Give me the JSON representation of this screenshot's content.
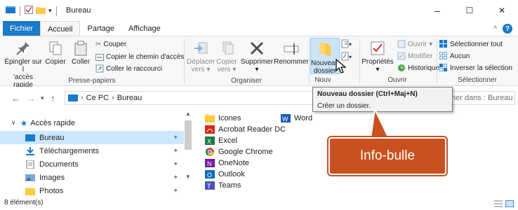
{
  "window": {
    "title": "Bureau",
    "controls": {
      "minimize": "–",
      "maximize": "☐",
      "close": "✕"
    }
  },
  "menu_tabs": [
    {
      "label": "Fichier"
    },
    {
      "label": "Accueil"
    },
    {
      "label": "Partage"
    },
    {
      "label": "Affichage"
    }
  ],
  "ribbon": {
    "groups": {
      "presse_papiers": "Presse-papiers",
      "organiser": "Organiser",
      "nouveau": "Nouv",
      "ouvrir": "Ouvrir",
      "selectionner": "Sélectionner"
    },
    "buttons": {
      "epingler": [
        "Épingler sur l",
        "'accès rapide"
      ],
      "copier": "Copier",
      "coller": "Coller",
      "couper": "Couper",
      "copier_chemin": "Copier le chemin d'accès",
      "coller_raccourci": "Coller le raccourci",
      "deplacer": [
        "Déplacer",
        "vers"
      ],
      "copier_vers": [
        "Copier",
        "vers"
      ],
      "supprimer": "Supprimer",
      "renommer": "Renommer",
      "nouveau_dossier": [
        "Nouveau",
        "dossier"
      ],
      "proprietes": "Propriétés",
      "ouvrir": "Ouvrir",
      "modifier": "Modifier",
      "historique": "Historique",
      "selectionner_tout": "Sélectionner tout",
      "aucun": "Aucun",
      "inverser": "Inverser la sélection"
    }
  },
  "address": {
    "path_root": "Ce PC",
    "path_current": "Bureau",
    "search_placeholder": "her dans : Bureau"
  },
  "tooltip": {
    "title": "Nouveau dossier (Ctrl+Maj+N)",
    "text": "Créer un dossier."
  },
  "nav_pane": {
    "quick_access": "Accès rapide",
    "items": [
      {
        "label": "Bureau"
      },
      {
        "label": "Téléchargements"
      },
      {
        "label": "Documents"
      },
      {
        "label": "Images"
      },
      {
        "label": "Photos"
      }
    ]
  },
  "files": [
    {
      "name": "Icones"
    },
    {
      "name": "Acrobat Reader DC"
    },
    {
      "name": "Excel"
    },
    {
      "name": "Google Chrome"
    },
    {
      "name": "OneNote"
    },
    {
      "name": "Outlook"
    },
    {
      "name": "Teams"
    },
    {
      "name": "Word"
    }
  ],
  "status": {
    "count": "8 élément(s)"
  },
  "callout": {
    "label": "Info-bulle"
  },
  "colors": {
    "accent": "#1979ca",
    "selection": "#cce8ff",
    "callout": "#c8511f"
  }
}
